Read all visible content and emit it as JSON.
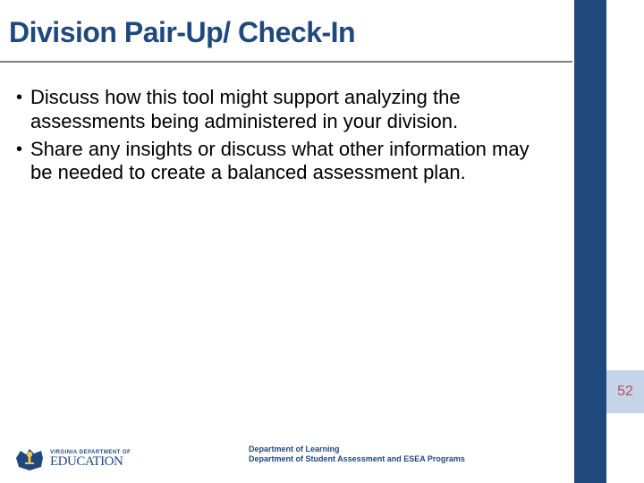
{
  "title": "Division Pair-Up/ Check-In",
  "bullets": [
    "Discuss how this tool might support analyzing the assessments being administered in your division.",
    "Share any insights or discuss what other information may be needed to create a balanced assessment plan."
  ],
  "pageNumber": "52",
  "logo": {
    "line1": "VIRGINIA DEPARTMENT OF",
    "line2": "EDUCATION"
  },
  "footer": {
    "line1": "Department of Learning",
    "line2": "Department of Student Assessment and ESEA Programs"
  }
}
